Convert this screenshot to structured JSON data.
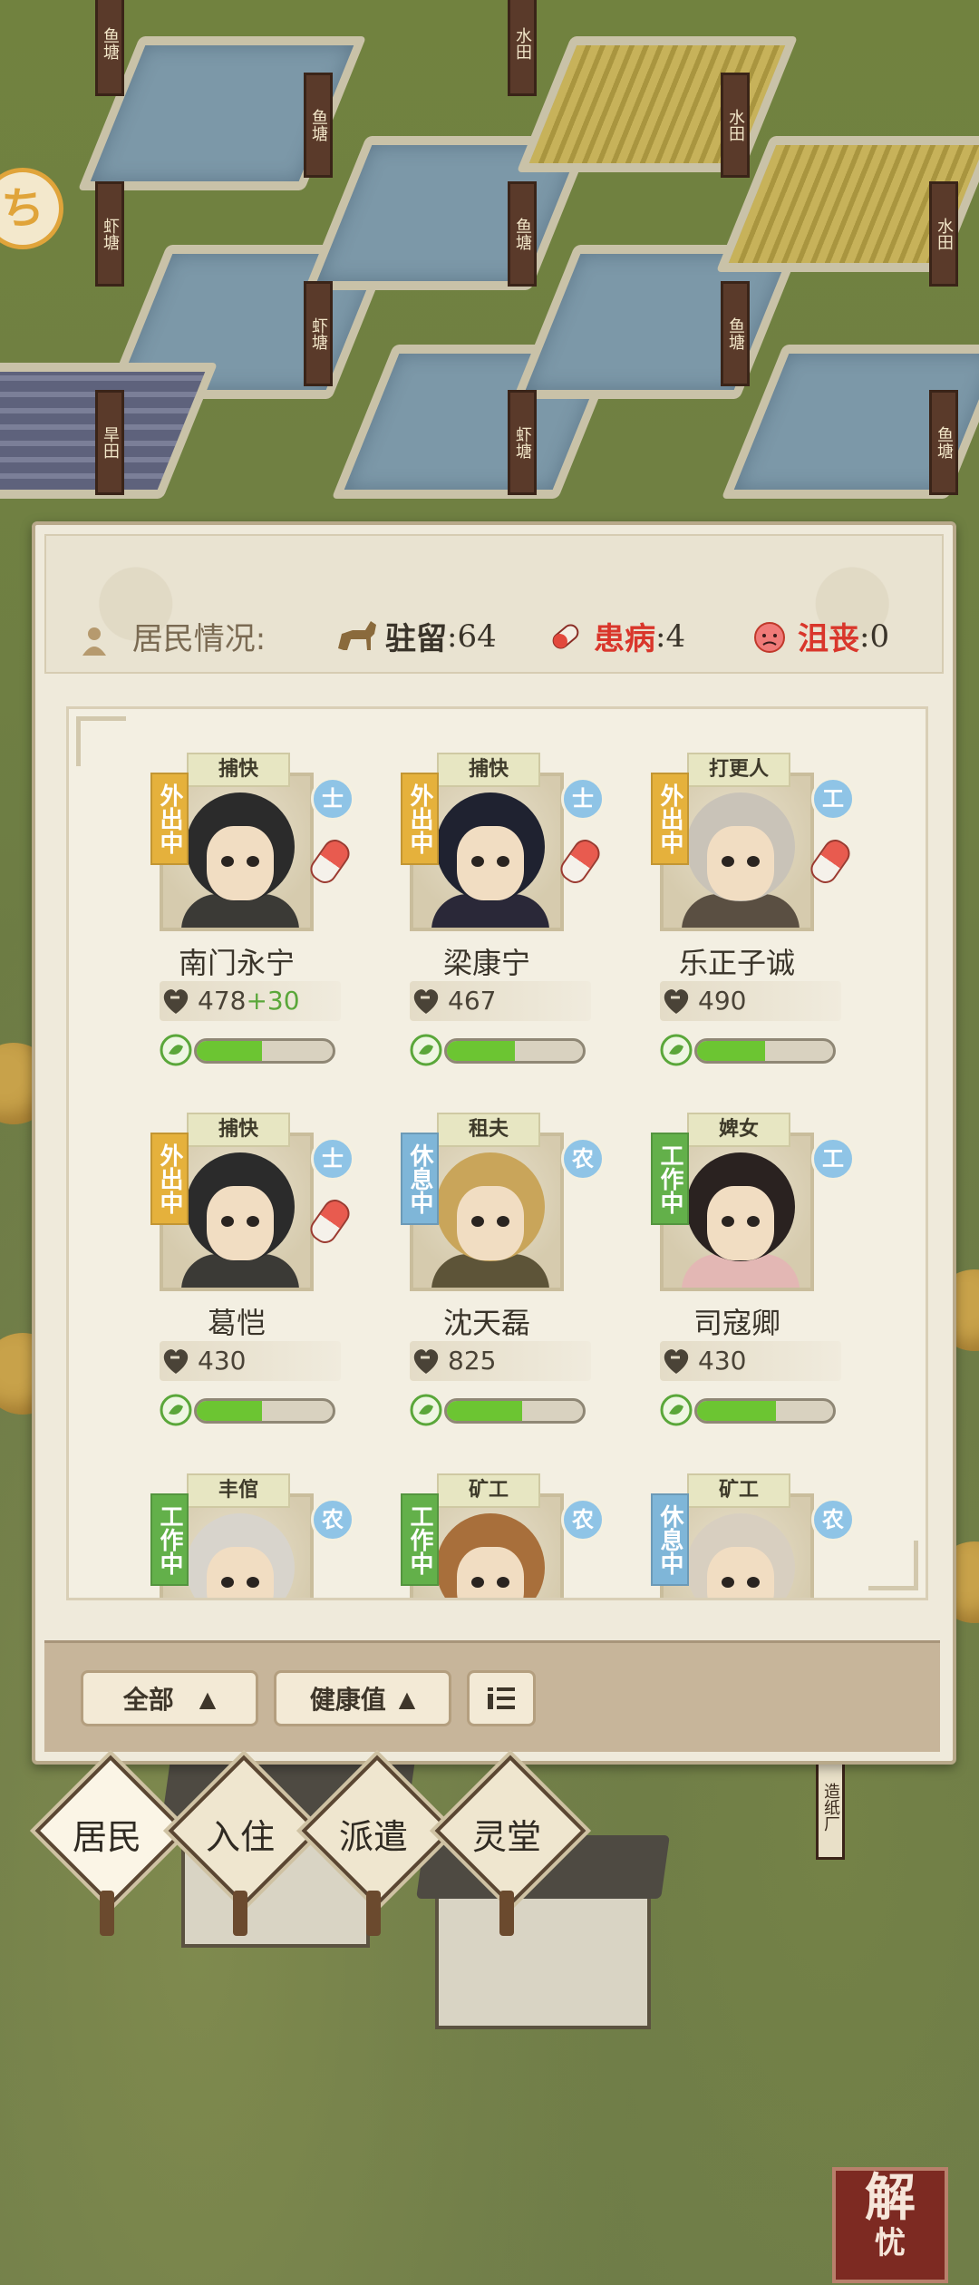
{
  "scene_signs": [
    "鱼塘",
    "水田",
    "鱼塘",
    "虾塘",
    "鱼塘",
    "水田",
    "鱼塘",
    "水田",
    "虾塘",
    "旱田",
    "虾塘",
    "鱼塘",
    "造纸厂"
  ],
  "status": {
    "label": "居民情况:",
    "stay": {
      "label": "驻留",
      "value": ":64"
    },
    "sick": {
      "label": "患病",
      "value": ":4"
    },
    "depressed": {
      "label": "沮丧",
      "value": ":0"
    }
  },
  "residents": [
    {
      "job": "捕快",
      "state": "外出中",
      "state_type": "out",
      "rank": "士",
      "name": "南门永宁",
      "health": "478",
      "bonus": "+30",
      "happy": 0.48,
      "sick": true
    },
    {
      "job": "捕快",
      "state": "外出中",
      "state_type": "out",
      "rank": "士",
      "name": "梁康宁",
      "health": "467",
      "bonus": "",
      "happy": 0.5,
      "sick": true
    },
    {
      "job": "打更人",
      "state": "外出中",
      "state_type": "out",
      "rank": "工",
      "name": "乐正子诚",
      "health": "490",
      "bonus": "",
      "happy": 0.5,
      "sick": true
    },
    {
      "job": "捕快",
      "state": "外出中",
      "state_type": "out",
      "rank": "士",
      "name": "葛恺",
      "health": "430",
      "bonus": "",
      "happy": 0.48,
      "sick": true
    },
    {
      "job": "租夫",
      "state": "休息中",
      "state_type": "rest",
      "rank": "农",
      "name": "沈天磊",
      "health": "825",
      "bonus": "",
      "happy": 0.55,
      "sick": false
    },
    {
      "job": "婢女",
      "state": "工作中",
      "state_type": "work",
      "rank": "工",
      "name": "司寇卿",
      "health": "430",
      "bonus": "",
      "happy": 0.58,
      "sick": false
    },
    {
      "job": "丰倌",
      "state": "工作中",
      "state_type": "work",
      "rank": "农",
      "name": "",
      "health": "",
      "bonus": "",
      "happy": 0,
      "sick": false
    },
    {
      "job": "矿工",
      "state": "工作中",
      "state_type": "work",
      "rank": "农",
      "name": "",
      "health": "",
      "bonus": "",
      "happy": 0,
      "sick": false
    },
    {
      "job": "矿工",
      "state": "休息中",
      "state_type": "rest",
      "rank": "农",
      "name": "",
      "health": "",
      "bonus": "",
      "happy": 0,
      "sick": false
    }
  ],
  "filters": {
    "all": "全部",
    "sort": "健康值",
    "list_icon": "list-toggle-icon"
  },
  "tabs": [
    {
      "label": "居民",
      "selected": true
    },
    {
      "label": "入住",
      "selected": false
    },
    {
      "label": "派遣",
      "selected": false
    },
    {
      "label": "灵堂",
      "selected": false
    }
  ],
  "seal": {
    "top": "解",
    "bottom": "忧"
  },
  "colors": {
    "stay": "#3a342a",
    "sick": "#d9362b",
    "depressed": "#d9362b",
    "bar": "#6cc532",
    "bonus": "#5aa73a"
  }
}
